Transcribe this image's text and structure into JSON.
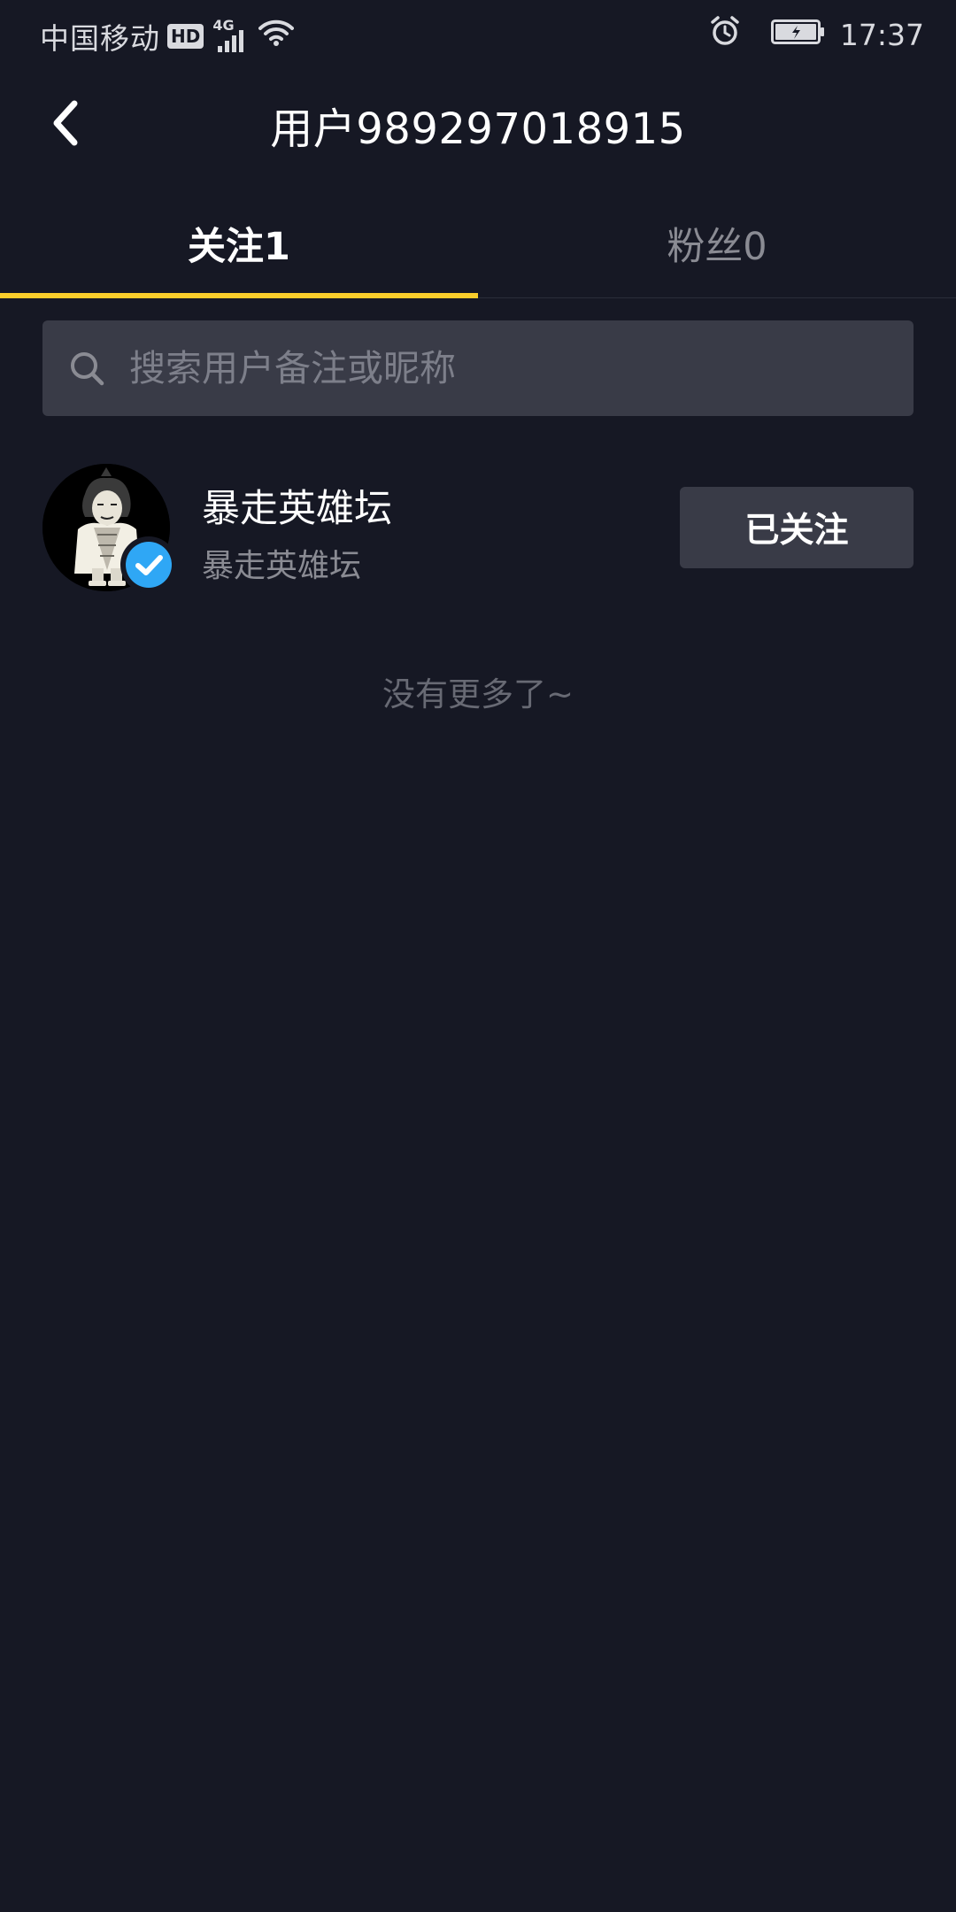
{
  "status_bar": {
    "carrier": "中国移动",
    "hd_badge": "HD",
    "network_type": "4G",
    "time": "17:37",
    "icons": [
      "hd-icon",
      "signal-icon",
      "wifi-icon",
      "alarm-icon",
      "battery-charging-icon"
    ]
  },
  "header": {
    "title": "用户989297018915",
    "back_icon": "chevron-left-icon"
  },
  "tabs": [
    {
      "label": "关注1",
      "active": true
    },
    {
      "label": "粉丝0",
      "active": false
    }
  ],
  "search": {
    "placeholder": "搜索用户备注或昵称",
    "value": "",
    "icon": "search-icon"
  },
  "following": [
    {
      "name": "暴走英雄坛",
      "subtitle": "暴走英雄坛",
      "verified": true,
      "button_label": "已关注"
    }
  ],
  "footer_text": "没有更多了~",
  "colors": {
    "background": "#161824",
    "accent": "#facd2b",
    "surface": "#393b47",
    "verified_blue": "#2fa7f5",
    "muted_text": "#8a8b93"
  }
}
